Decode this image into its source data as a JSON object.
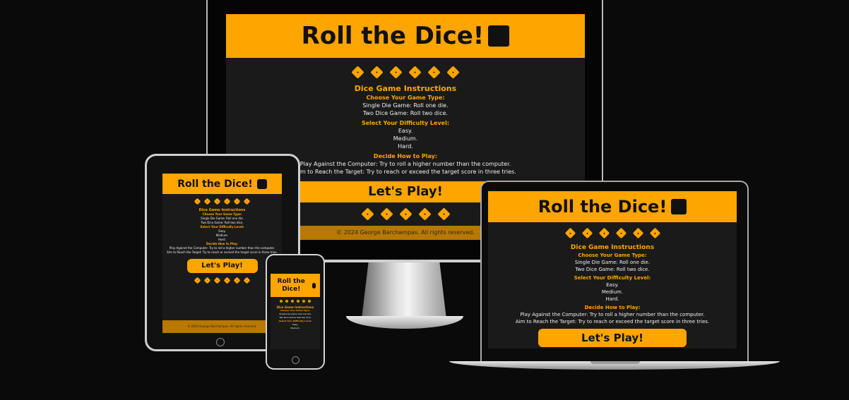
{
  "title": "Roll the Dice!",
  "dice_icon": "dice-icon",
  "instructions": {
    "heading": "Dice Game Instructions",
    "game_type_heading": "Choose Your Game Type:",
    "game_types": [
      "Single Die Game: Roll one die.",
      "Two Dice Game: Roll two dice."
    ],
    "difficulty_heading": "Select Your Difficulty Level:",
    "difficulties": [
      "Easy.",
      "Medium.",
      "Hard."
    ],
    "play_heading": "Decide How to Play:",
    "play_modes": [
      "Play Against the Computer: Try to roll a higher number than the computer.",
      "Aim to Reach the Target: Try to reach or exceed the target score in three tries."
    ]
  },
  "play_button": "Let's Play!",
  "footer": "© 2024 George Barchampas. All rights reserved.",
  "colors": {
    "accent": "#ffa500",
    "background": "#1a1a1a",
    "footer": "#b97800"
  }
}
